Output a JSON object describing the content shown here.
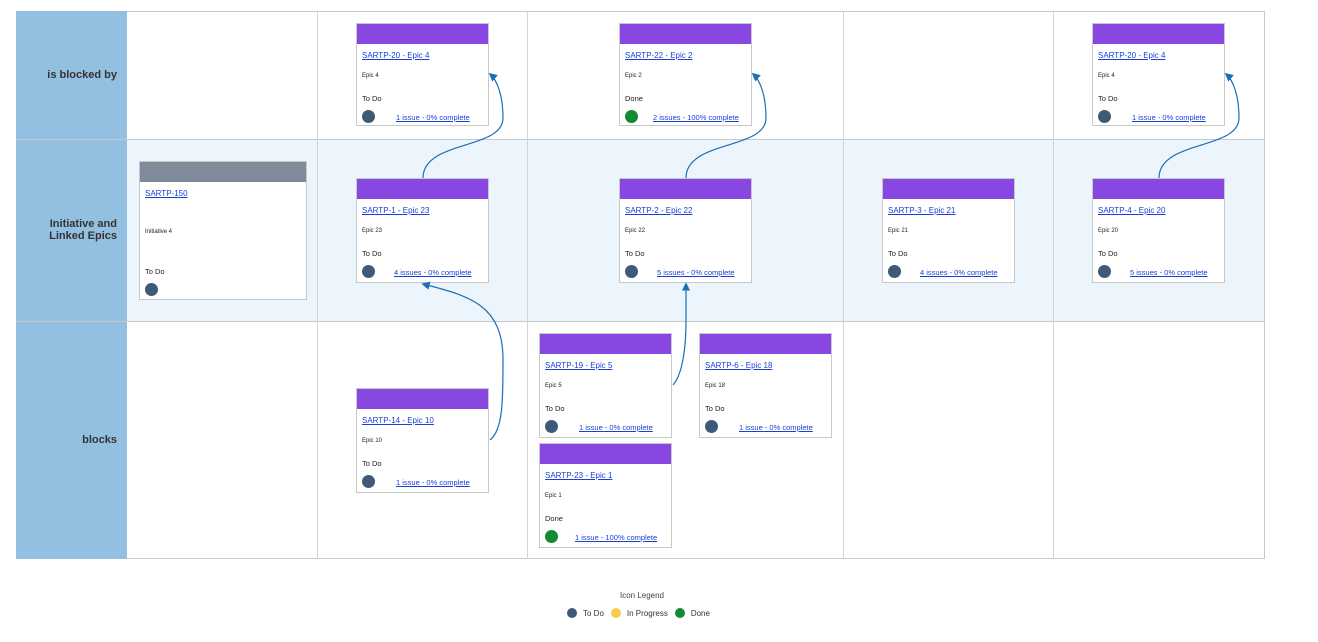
{
  "colors": {
    "todo": "#3d5a78",
    "in_progress": "#f8cc50",
    "done": "#118a32",
    "epic_bar": "#8747e0",
    "initiative_bar": "#7f8a9a",
    "arrow": "#1c6eb5"
  },
  "rows": {
    "blocked_by": "is blocked by",
    "initiative": "Initiative and Linked Epics",
    "blocks": "blocks"
  },
  "initiative": {
    "key": "SARTP-150",
    "desc": "Initiative 4",
    "status": "To Do",
    "status_icon": "todo-dot-icon"
  },
  "blocked_by_cards": [
    {
      "key": "SARTP-20 - Epic 4",
      "desc": "Epic 4",
      "status": "To Do",
      "state": "todo",
      "progress": "1 issue - 0% complete"
    },
    {
      "key": "SARTP-22 - Epic 2",
      "desc": "Epic 2",
      "status": "Done",
      "state": "done",
      "progress": "2 issues - 100% complete"
    },
    {
      "key": "SARTP-20 - Epic 4",
      "desc": "Epic 4",
      "status": "To Do",
      "state": "todo",
      "progress": "1 issue - 0% complete"
    }
  ],
  "linked_cards": [
    {
      "key": "SARTP-1 - Epic 23",
      "desc": "Epic 23",
      "status": "To Do",
      "state": "todo",
      "progress": "4 issues - 0% complete"
    },
    {
      "key": "SARTP-2 - Epic 22",
      "desc": "Epic 22",
      "status": "To Do",
      "state": "todo",
      "progress": "5 issues - 0% complete"
    },
    {
      "key": "SARTP-3 - Epic 21",
      "desc": "Epic 21",
      "status": "To Do",
      "state": "todo",
      "progress": "4 issues - 0% complete"
    },
    {
      "key": "SARTP-4 - Epic 20",
      "desc": "Epic 20",
      "status": "To Do",
      "state": "todo",
      "progress": "5 issues - 0% complete"
    }
  ],
  "blocks_cards": [
    {
      "key": "SARTP-14 - Epic 10",
      "desc": "Epic 10",
      "status": "To Do",
      "state": "todo",
      "progress": "1 issue - 0% complete"
    },
    {
      "key": "SARTP-19 - Epic 5",
      "desc": "Epic 5",
      "status": "To Do",
      "state": "todo",
      "progress": "1 issue - 0% complete"
    },
    {
      "key": "SARTP-6 - Epic 18",
      "desc": "Epic 18",
      "status": "To Do",
      "state": "todo",
      "progress": "1 issue - 0% complete"
    },
    {
      "key": "SARTP-23 - Epic 1",
      "desc": "Epic 1",
      "status": "Done",
      "state": "done",
      "progress": "1 issue - 100% complete"
    }
  ],
  "legend": {
    "title": "Icon Legend",
    "items": [
      {
        "label": "To Do",
        "state": "todo"
      },
      {
        "label": "In Progress",
        "state": "in_progress"
      },
      {
        "label": "Done",
        "state": "done"
      }
    ]
  }
}
